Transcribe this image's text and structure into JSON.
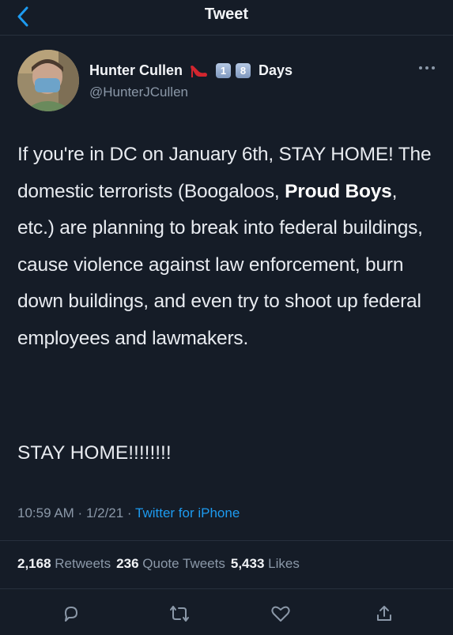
{
  "header": {
    "title": "Tweet"
  },
  "author": {
    "display_name": "Hunter Cullen",
    "badge_1": "1",
    "badge_2": "8",
    "badge_suffix": "Days",
    "handle": "@HunterJCullen"
  },
  "tweet": {
    "text_part1": "If you're in DC on January 6th, STAY HOME! The domestic terrorists (Boogaloos, ",
    "text_bold": "Proud Boys",
    "text_part2": ", etc.) are planning to break into federal buildings, cause violence against law enforcement, burn down buildings, and even try to shoot up federal employees and lawmakers.",
    "text_last": "STAY HOME!!!!!!!!"
  },
  "meta": {
    "time": "10:59 AM",
    "sep1": " · ",
    "date": "1/2/21",
    "sep2": " · ",
    "client": "Twitter for iPhone"
  },
  "stats": {
    "retweets_count": "2,168",
    "retweets_label": "Retweets",
    "quotes_count": "236",
    "quotes_label": "Quote Tweets",
    "likes_count": "5,433",
    "likes_label": "Likes"
  },
  "icons": {
    "back": "chevron-left-icon",
    "more": "more-icon",
    "reply": "reply-icon",
    "retweet": "retweet-icon",
    "like": "heart-icon",
    "share": "share-icon"
  },
  "colors": {
    "background": "#151c27",
    "accent": "#1d9bf0",
    "secondary_text": "#8b98a8"
  }
}
